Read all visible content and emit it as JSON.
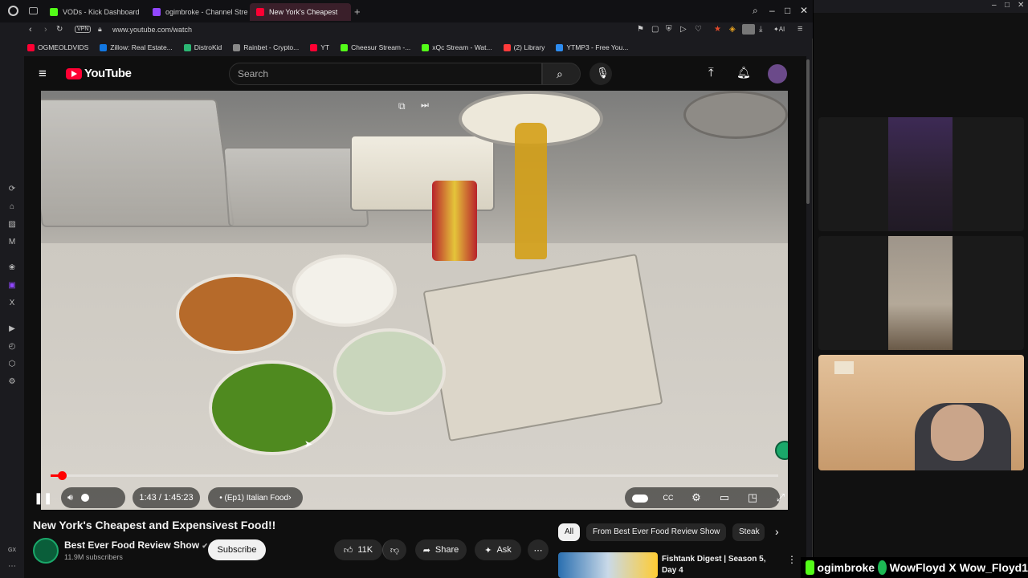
{
  "browser": {
    "tabs": [
      {
        "label": "VODs - Kick Dashboard",
        "color": "#53fc18"
      },
      {
        "label": "ogimbroke - Channel Stre",
        "color": "#9147ff"
      },
      {
        "label": "New York's Cheapest",
        "color": "#ff0033"
      }
    ],
    "url": "www.youtube.com/watch",
    "vpn": "VPN",
    "bookmarks": [
      {
        "label": "OGMEOLDVIDS",
        "color": "#ff0033"
      },
      {
        "label": "Zillow: Real Estate...",
        "color": "#1277e1"
      },
      {
        "label": "DistroKid",
        "color": "#2bb673"
      },
      {
        "label": "Rainbet - Crypto...",
        "color": "#888888"
      },
      {
        "label": "YT",
        "color": "#ff0033"
      },
      {
        "label": "Cheesur Stream -...",
        "color": "#53fc18"
      },
      {
        "label": "xQc Stream - Wat...",
        "color": "#53fc18"
      },
      {
        "label": "(2) Library",
        "color": "#ff3b3b"
      },
      {
        "label": "YTMP3 - Free You...",
        "color": "#2d8cf0"
      }
    ],
    "gx_label": "GX"
  },
  "youtube": {
    "logo": "YouTube",
    "search_placeholder": "Search",
    "player": {
      "time": "1:43 / 1:45:23",
      "chapter": "• (Ep1) Italian Food",
      "progress": 0.016
    },
    "video_title": "New York's Cheapest and Expensivest Food!!",
    "channel": {
      "name": "Best Ever Food Review Show",
      "subscribers": "11.9M subscribers",
      "subscribe_label": "Subscribe"
    },
    "actions": {
      "likes": "11K",
      "share": "Share",
      "ask": "Ask"
    },
    "chips": [
      "All",
      "From Best Ever Food Review Show",
      "Steak"
    ],
    "recommended": {
      "title": "Fishtank Digest | Season 5, Day 4"
    }
  },
  "overlay": {
    "handles": [
      {
        "label": "ogimbroke",
        "color": "#53fc18"
      },
      {
        "label": "WowFloyd",
        "color": "#1db954"
      },
      {
        "label": "Wow_Floyd1",
        "color": "#ffffff"
      }
    ]
  }
}
